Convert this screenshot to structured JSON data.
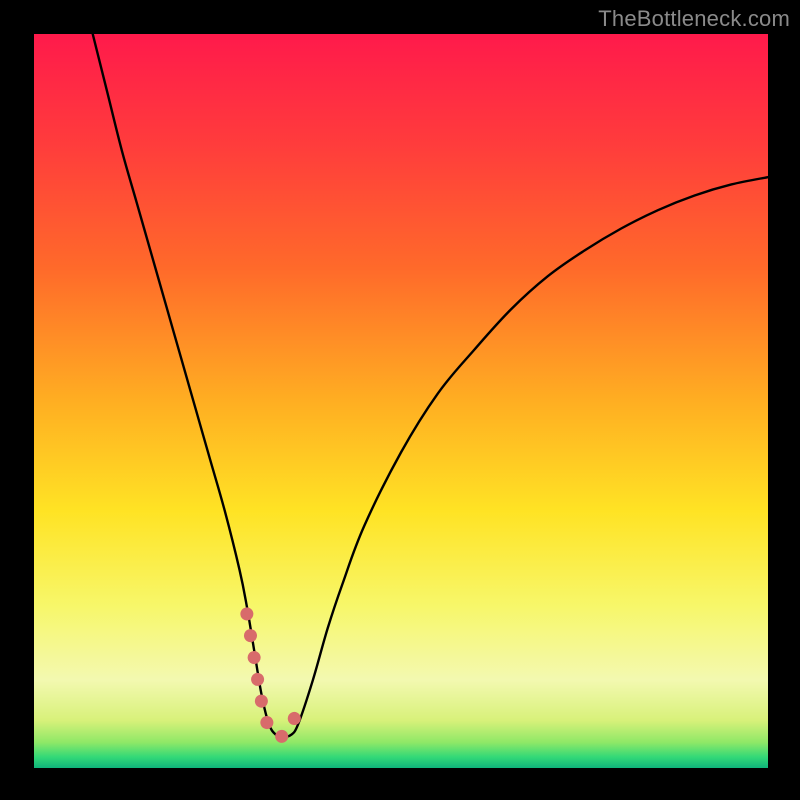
{
  "watermark": "TheBottleneck.com",
  "chart_data": {
    "type": "line",
    "title": "",
    "xlabel": "",
    "ylabel": "",
    "xlim": [
      0,
      100
    ],
    "ylim": [
      0,
      100
    ],
    "series": [
      {
        "name": "bottleneck-curve",
        "x": [
          8,
          10,
          12,
          14,
          16,
          18,
          20,
          22,
          24,
          26,
          28,
          29,
          30,
          31,
          32,
          33,
          34,
          35,
          36,
          38,
          40,
          42,
          45,
          50,
          55,
          60,
          65,
          70,
          75,
          80,
          85,
          90,
          95,
          100
        ],
        "values": [
          100,
          92,
          84,
          77,
          70,
          63,
          56,
          49,
          42,
          35,
          27,
          22,
          16,
          10,
          6,
          4.5,
          4.3,
          4.5,
          6,
          12,
          19,
          25,
          33,
          43,
          51,
          57,
          62.5,
          67,
          70.5,
          73.5,
          76,
          78,
          79.5,
          80.5
        ]
      },
      {
        "name": "sweet-spot-marker",
        "x": [
          29,
          30,
          31,
          32,
          33,
          33.5,
          34,
          35,
          36
        ],
        "values": [
          21,
          15,
          9,
          5.5,
          4.5,
          4.3,
          4.5,
          5.8,
          8
        ]
      }
    ],
    "background_gradient": {
      "stops": [
        {
          "offset": 0.0,
          "color": "#ff1a4b"
        },
        {
          "offset": 0.15,
          "color": "#ff3c3c"
        },
        {
          "offset": 0.32,
          "color": "#ff6a2a"
        },
        {
          "offset": 0.5,
          "color": "#ffae22"
        },
        {
          "offset": 0.65,
          "color": "#ffe324"
        },
        {
          "offset": 0.78,
          "color": "#f7f76a"
        },
        {
          "offset": 0.88,
          "color": "#f3f9b0"
        },
        {
          "offset": 0.935,
          "color": "#d8f17a"
        },
        {
          "offset": 0.965,
          "color": "#8fe867"
        },
        {
          "offset": 0.985,
          "color": "#33d977"
        },
        {
          "offset": 1.0,
          "color": "#0fb47a"
        }
      ]
    }
  }
}
